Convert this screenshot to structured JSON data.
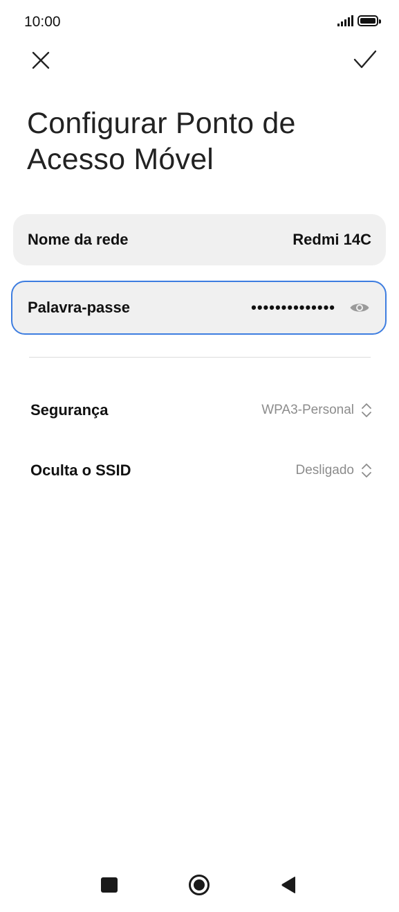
{
  "status_bar": {
    "time": "10:00",
    "icons": [
      "signal-icon",
      "battery-icon"
    ]
  },
  "header": {
    "close_icon": "close-icon",
    "confirm_icon": "check-icon",
    "title": "Configurar Ponto de Acesso Móvel"
  },
  "form": {
    "network_name": {
      "label": "Nome da rede",
      "value": "Redmi 14C"
    },
    "password": {
      "label": "Palavra-passe",
      "masked_value": "••••••••••••••",
      "toggle_icon": "eye-icon"
    },
    "security": {
      "label": "Segurança",
      "value": "WPA3-Personal",
      "icon": "up-down-chevron-icon"
    },
    "hide_ssid": {
      "label": "Oculta o SSID",
      "value": "Desligado",
      "icon": "up-down-chevron-icon"
    }
  },
  "colors": {
    "accent": "#3d7de0",
    "field_bg": "#f0f0f0",
    "secondary_text": "#8c8c8c"
  },
  "nav_bar": {
    "buttons": [
      "recent-apps-icon",
      "home-icon",
      "back-icon"
    ]
  }
}
